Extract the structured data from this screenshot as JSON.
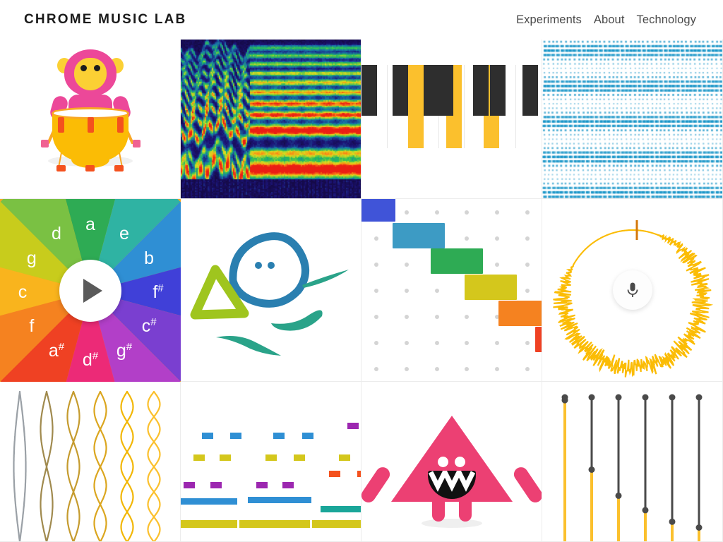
{
  "header": {
    "logo": "CHROME MUSIC LAB",
    "nav": [
      {
        "label": "Experiments",
        "name": "nav-experiments"
      },
      {
        "label": "About",
        "name": "nav-about"
      },
      {
        "label": "Technology",
        "name": "nav-technology"
      }
    ]
  },
  "colors": {
    "text_dark": "#1a1a1a",
    "text_nav": "#4a4a4a",
    "pink": "#ec4899",
    "yellow": "#fbbc05",
    "amber": "#fbc02d",
    "blue_dot": "#2196c4",
    "orange_wave": "#fbbc05",
    "grid_line": "#ececec",
    "grid_dot": "#d4d4d4"
  },
  "grid": {
    "columns": 4,
    "rows": 3,
    "tiles": [
      {
        "name": "tile-rhythm",
        "title": "Rhythm",
        "row": 1,
        "col": 1
      },
      {
        "name": "tile-spectrogram",
        "title": "Spectrogram",
        "row": 1,
        "col": 2
      },
      {
        "name": "tile-chords",
        "title": "Chords",
        "row": 1,
        "col": 3
      },
      {
        "name": "tile-sound-waves",
        "title": "Sound Waves",
        "row": 1,
        "col": 4
      },
      {
        "name": "tile-arpeggios",
        "title": "Arpeggios",
        "row": 2,
        "col": 1
      },
      {
        "name": "tile-kandinsky",
        "title": "Kandinsky",
        "row": 2,
        "col": 2
      },
      {
        "name": "tile-melody-maker",
        "title": "Melody Maker",
        "row": 2,
        "col": 3
      },
      {
        "name": "tile-voice-spinner",
        "title": "Voice Spinner",
        "row": 2,
        "col": 4
      },
      {
        "name": "tile-strings",
        "title": "Strings",
        "row": 3,
        "col": 1
      },
      {
        "name": "tile-song-maker",
        "title": "Song Maker",
        "row": 3,
        "col": 2
      },
      {
        "name": "tile-oscillators",
        "title": "Oscillators",
        "row": 3,
        "col": 3
      },
      {
        "name": "tile-harmonics",
        "title": "Harmonics",
        "row": 3,
        "col": 4
      }
    ]
  },
  "arpeggios_wheel": {
    "play_button": "play-icon",
    "segments": [
      {
        "note": "a",
        "color": "#2eab54"
      },
      {
        "note": "e",
        "color": "#2fb3a3"
      },
      {
        "note": "b",
        "color": "#2f8fd4"
      },
      {
        "note": "f",
        "sharp": true,
        "color": "#4040d8"
      },
      {
        "note": "c",
        "sharp": true,
        "color": "#7a3fd0"
      },
      {
        "note": "g",
        "sharp": true,
        "color": "#b23fc8"
      },
      {
        "note": "d",
        "sharp": true,
        "color": "#ec2a77"
      },
      {
        "note": "a",
        "sharp": true,
        "color": "#ef4123"
      },
      {
        "note": "f",
        "color": "#f58220"
      },
      {
        "note": "c",
        "color": "#f9b41d"
      },
      {
        "note": "g",
        "color": "#c8cc1c"
      },
      {
        "note": "d",
        "color": "#7ac143"
      }
    ]
  },
  "chords_piano": {
    "white_key_count": 7,
    "black_key_positions": [
      0,
      1,
      3,
      4,
      5
    ],
    "highlighted_keys": [
      "key-1",
      "key-3",
      "key-5"
    ]
  },
  "melody_maker": {
    "block_colors": [
      "#4054d8",
      "#3d9bc4",
      "#2eab54",
      "#d4c71c",
      "#f58220",
      "#ef4123"
    ],
    "grid_rows": 7,
    "grid_cols": 6
  },
  "song_maker": {
    "note_colors": {
      "blue": "#2f8fd4",
      "yellow": "#d4c71c",
      "purple": "#9c27b0",
      "orange": "#f4511e",
      "teal": "#1aa699"
    }
  },
  "strings": {
    "count": 6,
    "colors": [
      "#9aa0a6",
      "#a08a4e",
      "#c59b2e",
      "#dba61f",
      "#f2b705",
      "#fbc02d"
    ],
    "node_counts": [
      1,
      2,
      3,
      4,
      5,
      6
    ]
  },
  "harmonics": {
    "count": 6,
    "dark_color": "#4a4a4a",
    "bright_color": "#fbc02d",
    "node_fractions": [
      0.02,
      0.5,
      0.68,
      0.78,
      0.86,
      0.9
    ]
  },
  "voice_spinner": {
    "mic_icon": "microphone-icon",
    "wave_color": "#fbbc05",
    "playhead_color": "#d4780a"
  },
  "sound_waves": {
    "dot_color": "#2196c4",
    "cols": 42,
    "rows": 36
  }
}
